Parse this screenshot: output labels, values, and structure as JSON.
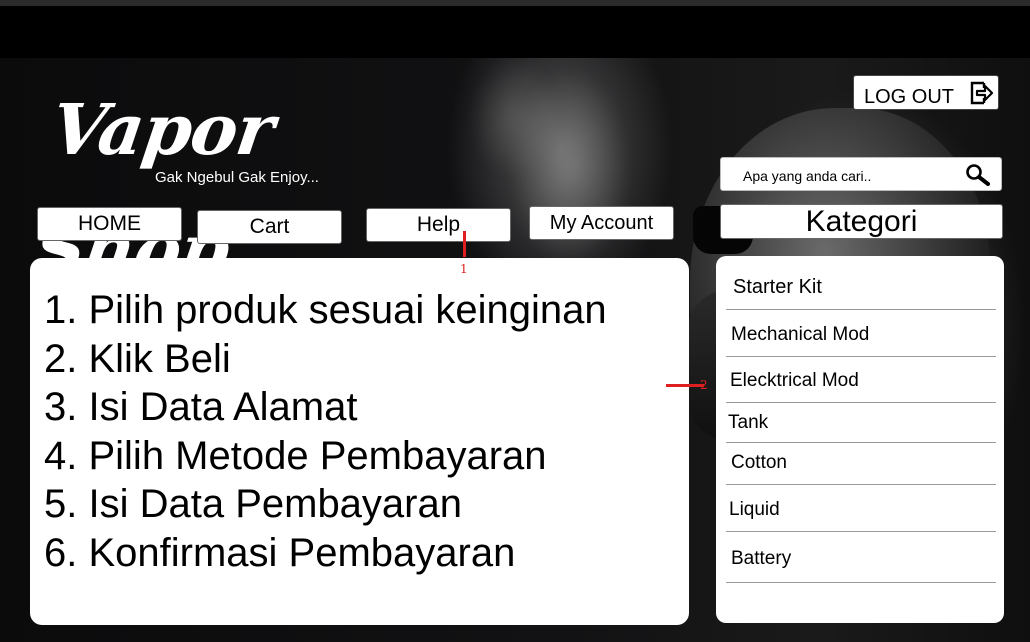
{
  "brand": {
    "logo_text": "Vapor Shop",
    "tagline": "Gak Ngebul Gak Enjoy..."
  },
  "header": {
    "logout_label": "LOG OUT",
    "logout_icon": "logout-icon"
  },
  "search": {
    "placeholder": "Apa yang anda cari..",
    "icon": "search-icon"
  },
  "nav": {
    "home": "HOME",
    "cart": "Cart",
    "help": "Help",
    "account": "My Account"
  },
  "help_steps": [
    "1. Pilih produk sesuai keinginan",
    "2. Klik Beli",
    "3. Isi Data Alamat",
    "4. Pilih Metode Pembayaran",
    "5. Isi Data Pembayaran",
    "6. Konfirmasi Pembayaran"
  ],
  "kategori": {
    "title": "Kategori",
    "items": [
      "Starter Kit",
      "Mechanical Mod",
      "Elecktrical Mod",
      "Tank",
      "Cotton",
      "Liquid",
      "Battery"
    ]
  },
  "annotations": [
    "1",
    "2"
  ],
  "colors": {
    "annotation": "#e02020",
    "background": "#000000",
    "panel": "#ffffff"
  }
}
